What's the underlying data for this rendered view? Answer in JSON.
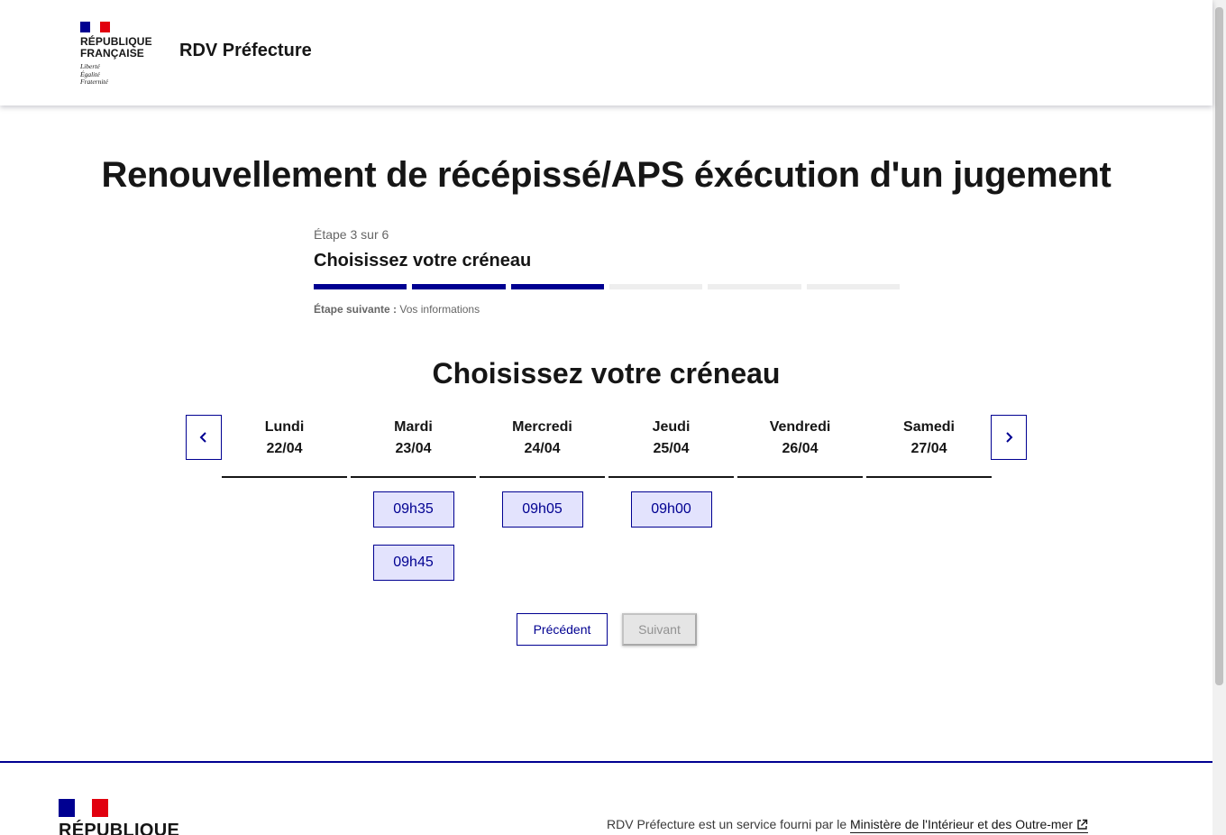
{
  "header": {
    "marianne_line1": "RÉPUBLIQUE",
    "marianne_line2": "FRANÇAISE",
    "motto": [
      "Liberté",
      "Égalité",
      "Fraternité"
    ],
    "service_title": "RDV Préfecture"
  },
  "page_title": "Renouvellement de récépissé/APS éxécution d'un jugement",
  "stepper": {
    "state": "Étape 3 sur 6",
    "title": "Choisissez votre créneau",
    "current_step": 3,
    "total_steps": 6,
    "next_label": "Étape suivante :",
    "next_value": "Vos informations"
  },
  "section_title": "Choisissez votre créneau",
  "calendar": {
    "prev_icon": "chevron-left-icon",
    "next_icon": "chevron-right-icon",
    "days": [
      {
        "name": "Lundi",
        "date": "22/04",
        "slots": []
      },
      {
        "name": "Mardi",
        "date": "23/04",
        "slots": [
          "09h35",
          "09h45"
        ]
      },
      {
        "name": "Mercredi",
        "date": "24/04",
        "slots": [
          "09h05"
        ]
      },
      {
        "name": "Jeudi",
        "date": "25/04",
        "slots": [
          "09h00"
        ]
      },
      {
        "name": "Vendredi",
        "date": "26/04",
        "slots": []
      },
      {
        "name": "Samedi",
        "date": "27/04",
        "slots": []
      }
    ]
  },
  "buttons": {
    "previous": "Précédent",
    "next": "Suivant"
  },
  "footer": {
    "republique": "RÉPUBLIQUE",
    "text": "RDV Préfecture est un service fourni par le",
    "link": "Ministère de l'Intérieur et des Outre-mer",
    "link_icon": "external-link-icon"
  },
  "colors": {
    "primary": "#000091",
    "slot_bg": "#e3e3fd",
    "flag_red": "#e1000f",
    "disabled_bg": "#e5e5e5"
  }
}
